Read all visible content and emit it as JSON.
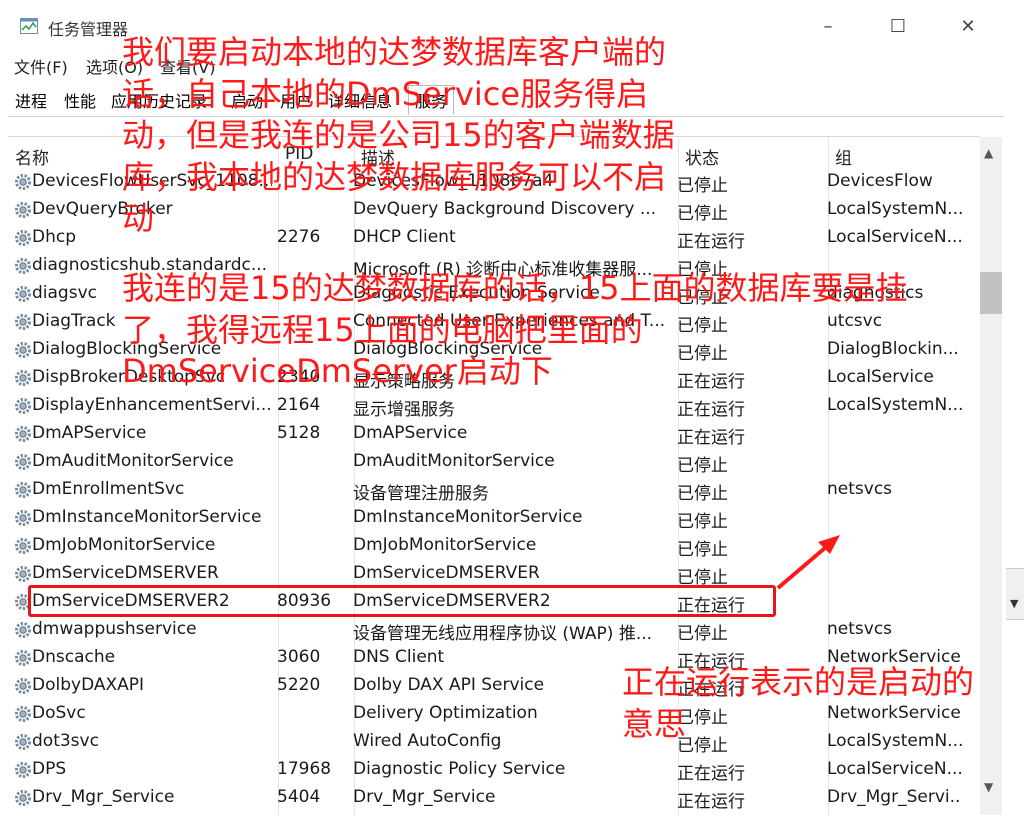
{
  "window": {
    "title": "任务管理器"
  },
  "menu": [
    "文件(F)",
    "选项(O)",
    "查看(V)"
  ],
  "tabs": [
    "进程",
    "性能",
    "应用历史记录",
    "启动",
    "用户",
    "详细信息",
    "服务"
  ],
  "columns": {
    "name": "名称",
    "pid": "PID",
    "desc": "描述",
    "status": "状态",
    "group": "组"
  },
  "rows": [
    {
      "name": "DevicesFlowUserSvc_1108...",
      "pid": "",
      "desc": "DevicesFlow_1108b7a4",
      "status": "已停止",
      "group": "DevicesFlow"
    },
    {
      "name": "DevQueryBroker",
      "pid": "",
      "desc": "DevQuery Background Discovery ...",
      "status": "已停止",
      "group": "LocalSystemN..."
    },
    {
      "name": "Dhcp",
      "pid": "2276",
      "desc": "DHCP Client",
      "status": "正在运行",
      "group": "LocalServiceN..."
    },
    {
      "name": "diagnosticshub.standardc...",
      "pid": "",
      "desc": "Microsoft (R) 诊断中心标准收集器服...",
      "status": "已停止",
      "group": ""
    },
    {
      "name": "diagsvc",
      "pid": "",
      "desc": "Diagnostic Execution Service",
      "status": "已停止",
      "group": "diagnostics"
    },
    {
      "name": "DiagTrack",
      "pid": "",
      "desc": "Connected User Experiences and T...",
      "status": "已停止",
      "group": "utcsvc"
    },
    {
      "name": "DialogBlockingService",
      "pid": "",
      "desc": "DialogBlockingService",
      "status": "已停止",
      "group": "DialogBlockin..."
    },
    {
      "name": "DispBrokerDesktopSvc",
      "pid": "2340",
      "desc": "显示策略服务",
      "status": "正在运行",
      "group": "LocalService"
    },
    {
      "name": "DisplayEnhancementServi...",
      "pid": "2164",
      "desc": "显示增强服务",
      "status": "正在运行",
      "group": "LocalSystemN..."
    },
    {
      "name": "DmAPService",
      "pid": "5128",
      "desc": "DmAPService",
      "status": "正在运行",
      "group": ""
    },
    {
      "name": "DmAuditMonitorService",
      "pid": "",
      "desc": "DmAuditMonitorService",
      "status": "已停止",
      "group": ""
    },
    {
      "name": "DmEnrollmentSvc",
      "pid": "",
      "desc": "设备管理注册服务",
      "status": "已停止",
      "group": "netsvcs"
    },
    {
      "name": "DmInstanceMonitorService",
      "pid": "",
      "desc": "DmInstanceMonitorService",
      "status": "已停止",
      "group": ""
    },
    {
      "name": "DmJobMonitorService",
      "pid": "",
      "desc": "DmJobMonitorService",
      "status": "已停止",
      "group": ""
    },
    {
      "name": "DmServiceDMSERVER",
      "pid": "",
      "desc": "DmServiceDMSERVER",
      "status": "已停止",
      "group": ""
    },
    {
      "name": "DmServiceDMSERVER2",
      "pid": "80936",
      "desc": "DmServiceDMSERVER2",
      "status": "正在运行",
      "group": ""
    },
    {
      "name": "dmwappushservice",
      "pid": "",
      "desc": "设备管理无线应用程序协议 (WAP) 推...",
      "status": "已停止",
      "group": "netsvcs"
    },
    {
      "name": "Dnscache",
      "pid": "3060",
      "desc": "DNS Client",
      "status": "正在运行",
      "group": "NetworkService"
    },
    {
      "name": "DolbyDAXAPI",
      "pid": "5220",
      "desc": "Dolby DAX API Service",
      "status": "正在运行",
      "group": ""
    },
    {
      "name": "DoSvc",
      "pid": "",
      "desc": "Delivery Optimization",
      "status": "已停止",
      "group": "NetworkService"
    },
    {
      "name": "dot3svc",
      "pid": "",
      "desc": "Wired AutoConfig",
      "status": "已停止",
      "group": "LocalSystemN..."
    },
    {
      "name": "DPS",
      "pid": "17968",
      "desc": "Diagnostic Policy Service",
      "status": "正在运行",
      "group": "LocalServiceN..."
    },
    {
      "name": "Drv_Mgr_Service",
      "pid": "5404",
      "desc": "Drv_Mgr_Service",
      "status": "正在运行",
      "group": "Drv_Mgr_Servi..."
    }
  ],
  "annotations": {
    "top": "我们要启动本地的达梦数据库客户端的话，自己本地的DmService服务得启动，但是我连的是公司15的客户端数据库，我本地的达梦数据库服务可以不启动",
    "middle": "我连的是15的达梦数据库的话，15上面的数据库要是挂了，我得远程15上面的电脑把里面的DmServiceDmServer启动下",
    "bottom": "正在运行表示的是启动的意思"
  },
  "colors": {
    "annotation": "#ff1a1a",
    "highlight": "#e5161b"
  }
}
